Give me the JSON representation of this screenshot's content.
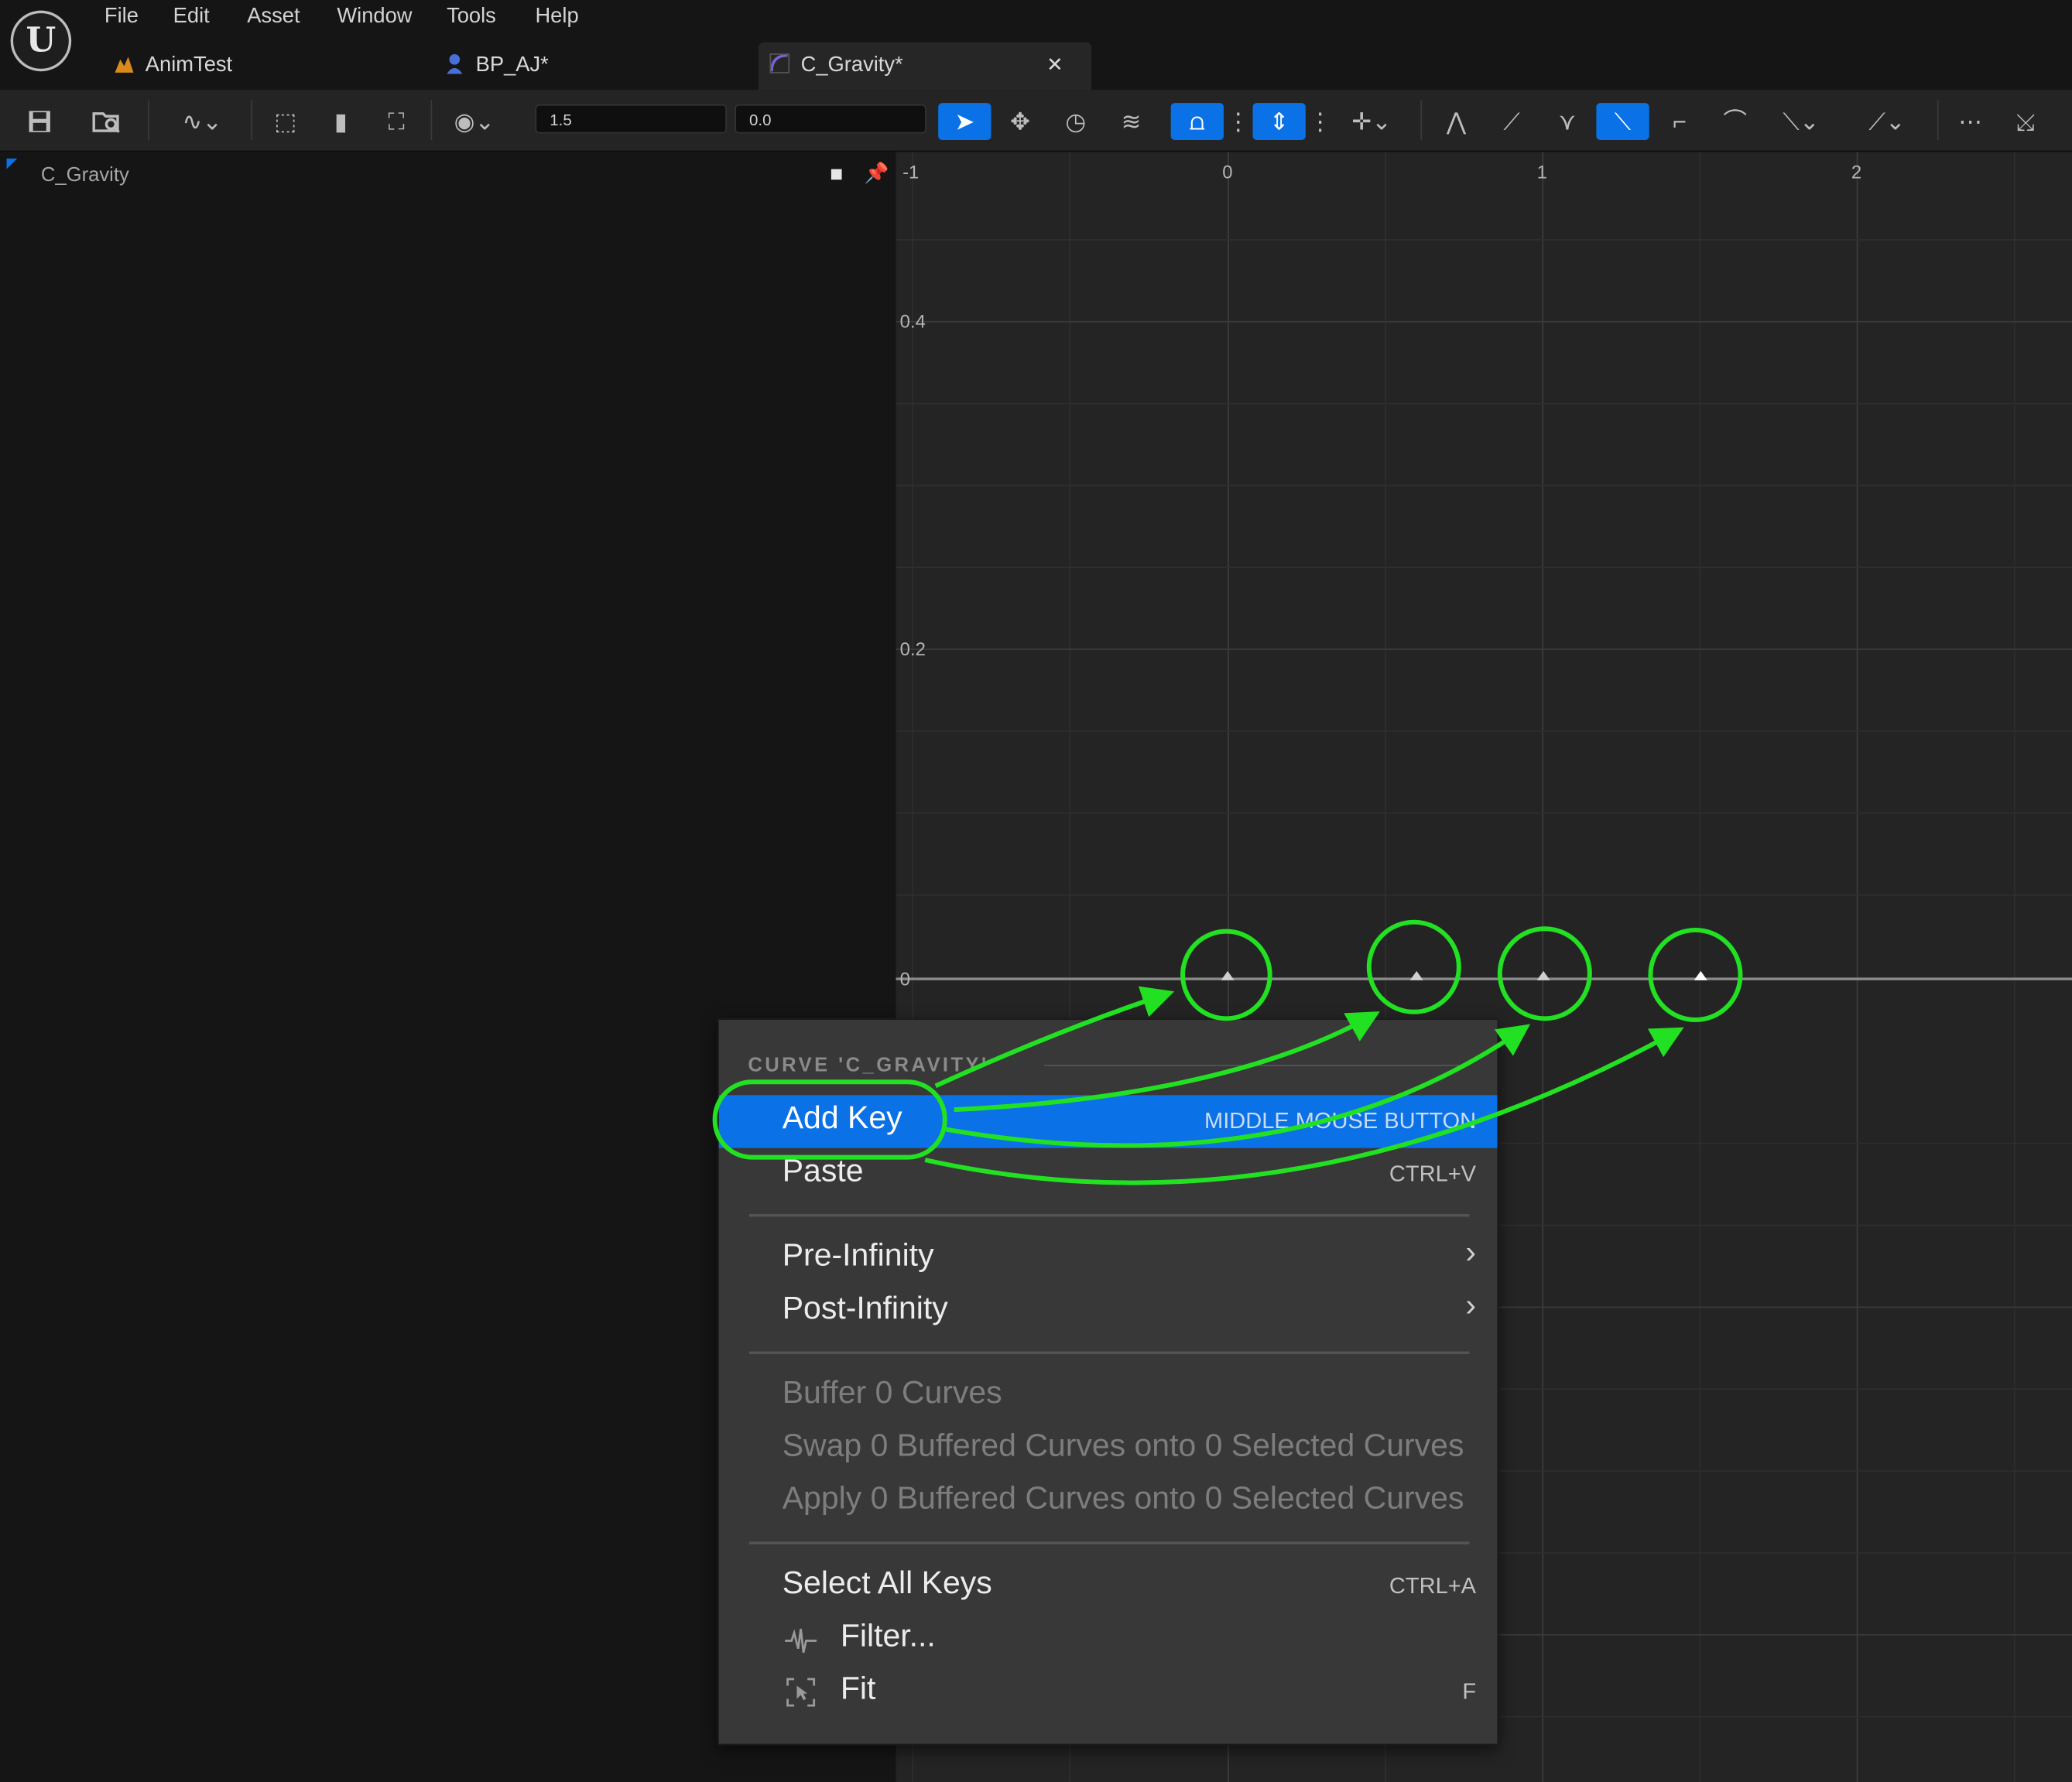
{
  "menubar": [
    "File",
    "Edit",
    "Asset",
    "Window",
    "Tools",
    "Help"
  ],
  "tabs": [
    {
      "label": "AnimTest",
      "icon": "level-icon",
      "color": "#d98a1e"
    },
    {
      "label": "BP_AJ*",
      "icon": "blueprint-character-icon",
      "color": "#4a6fd6"
    },
    {
      "label": "C_Gravity*",
      "icon": "curve-asset-icon",
      "color": "#7b5fd6"
    }
  ],
  "toolbar": {
    "value_1": "1.5",
    "value_2": "0.0",
    "accent": "#0a72e6"
  },
  "left_panel": {
    "curve_name": "C_Gravity"
  },
  "graph": {
    "x_ticks": [
      "-1",
      "0",
      "1",
      "2"
    ],
    "y_ticks": [
      "0.4",
      "0.2",
      "0"
    ],
    "keys": [
      0.0,
      0.6,
      1.0,
      1.5
    ],
    "annotation_color": "#22e022"
  },
  "context_menu": {
    "header": "CURVE 'C_GRAVITY'",
    "items": [
      {
        "label": "Add Key",
        "shortcut": "MIDDLE MOUSE BUTTON",
        "highlighted": true
      },
      {
        "label": "Paste",
        "shortcut": "CTRL+V"
      },
      {
        "label": "Pre-Infinity",
        "submenu": true
      },
      {
        "label": "Post-Infinity",
        "submenu": true
      },
      {
        "label": "Buffer 0 Curves",
        "disabled": true
      },
      {
        "label": "Swap 0 Buffered Curves onto 0 Selected Curves",
        "disabled": true
      },
      {
        "label": "Apply 0 Buffered Curves onto 0 Selected Curves",
        "disabled": true
      },
      {
        "label": "Select All Keys",
        "shortcut": "CTRL+A"
      },
      {
        "label": "Filter...",
        "icon": "filter-icon"
      },
      {
        "label": "Fit",
        "shortcut": "F",
        "icon": "fit-icon"
      }
    ]
  }
}
